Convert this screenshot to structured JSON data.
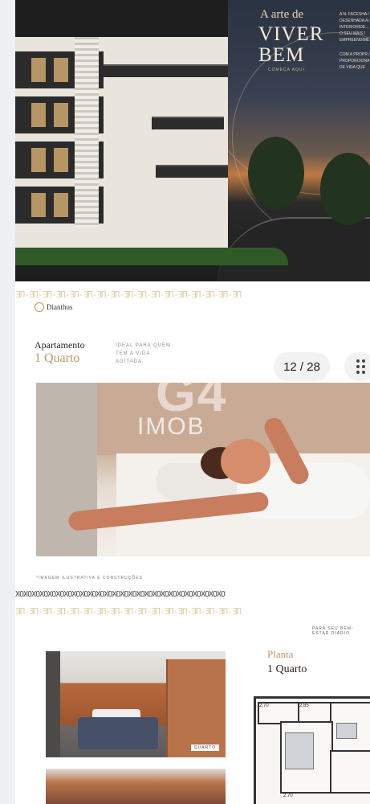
{
  "hero": {
    "title_small": "A arte de",
    "title_big_line1": "VIVER",
    "title_big_line2": "BEM",
    "subtitle": "COMEÇA AQUI",
    "side_text_1": "A N. FACESHA / DESENHADA A / INTERIORIDE... / O SEU MAIS / EMPREENDIME...",
    "side_text_2": "COM A PROPR / PROPORCIONA / DE VIDA QUE"
  },
  "pattern_top": "ƎП-ƎП-ƎП-ƎП-ƎП-ƎП-ƎП-ƎП-ƎП-ƎП-ƎП-ƎП-ƎП-ƎП-ƎП-ƎП-ƎП",
  "brand": {
    "name": "Dianthus"
  },
  "apartment": {
    "title": "Apartamento",
    "subtitle": "1 Quarto",
    "ideal_line1": "IDEAL PARA QUEM",
    "ideal_line2": "TEM A VIDA",
    "ideal_line3": "AGITADA"
  },
  "gallery": {
    "counter": "12 / 28",
    "more_icon": "grid-dots-icon"
  },
  "watermark": {
    "big": "G4",
    "small": "IMOB"
  },
  "photo_caption": "*IMAGEM ILUSTRATIVA E CONSTRUÇÕES",
  "pattern_mid": "XOXOXOXOXOXOXOXOXOXOXOXOXOXOXOXOXOXOXOXOXOXOXOXOXOXO",
  "pattern_mid2": "ƎП-ƎП-ƎП-ƎП-ƎП-ƎП-ƎП-ƎП-ƎП-ƎП-ƎП-ƎП-ƎП-ƎП-ƎП-ƎП-ƎП",
  "section_tagline": "PARA SEU BEM-ESTAR DIÁRIO",
  "room_tag": "QUARTO",
  "plan": {
    "title": "Planta",
    "subtitle": "1 Quarto",
    "labels": [
      "2,70",
      "2,85",
      "2,70"
    ]
  },
  "colors": {
    "gold": "#b79a64",
    "dark": "#2b2520"
  }
}
